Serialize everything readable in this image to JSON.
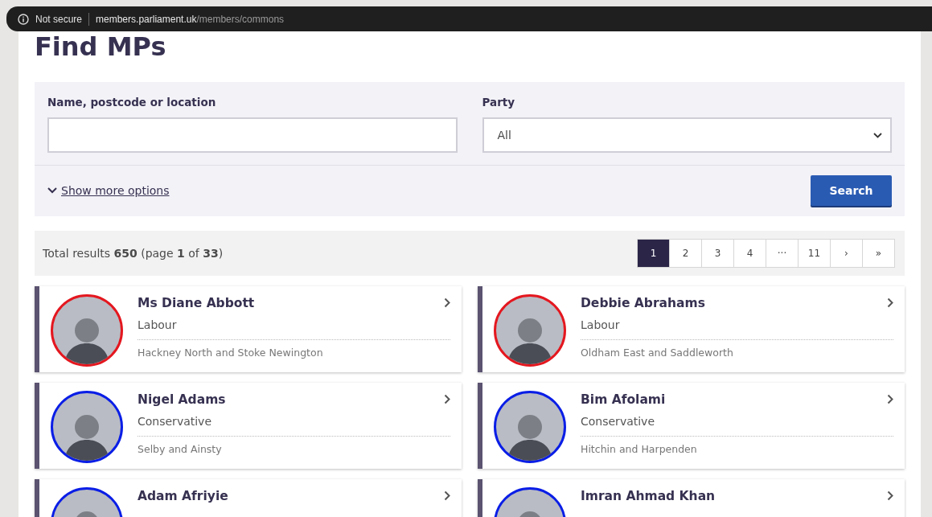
{
  "browser": {
    "security": "Not secure",
    "url_host": "members.parliament.uk",
    "url_path": "/members/commons"
  },
  "title": "Find MPs",
  "filters": {
    "name_label": "Name, postcode or location",
    "party_label": "Party",
    "party_value": "All",
    "more_options": "Show more options",
    "search_button": "Search"
  },
  "results": {
    "summary": "Total results **650** (page **1** of **33**)"
  },
  "pagination": [
    {
      "label": "1",
      "selected": true
    },
    {
      "label": "2",
      "selected": false
    },
    {
      "label": "3",
      "selected": false
    },
    {
      "label": "4",
      "selected": false
    },
    {
      "label": "···",
      "selected": false
    },
    {
      "label": "11",
      "selected": false
    },
    {
      "label": "›",
      "selected": false
    },
    {
      "label": "»",
      "selected": false
    }
  ],
  "members": [
    {
      "name": "Ms Diane Abbott",
      "party": "Labour",
      "constituency": "Hackney North and Stoke Newington",
      "color": "#e4171f"
    },
    {
      "name": "Debbie Abrahams",
      "party": "Labour",
      "constituency": "Oldham East and Saddleworth",
      "color": "#e4171f"
    },
    {
      "name": "Nigel Adams",
      "party": "Conservative",
      "constituency": "Selby and Ainsty",
      "color": "#0a1ee6"
    },
    {
      "name": "Bim Afolami",
      "party": "Conservative",
      "constituency": "Hitchin and Harpenden",
      "color": "#0a1ee6"
    },
    {
      "name": "Adam Afriyie",
      "color": "#0a1ee6"
    },
    {
      "name": "Imran Ahmad Khan",
      "color": "#0a1ee6"
    }
  ]
}
